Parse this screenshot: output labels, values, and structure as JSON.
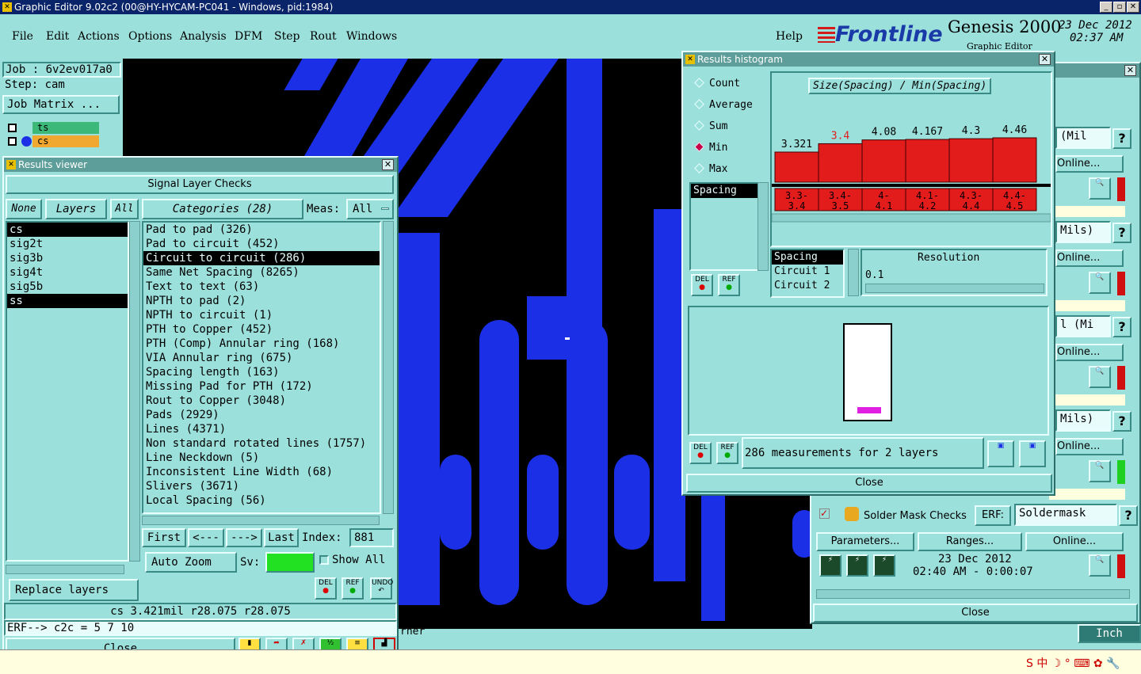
{
  "window": {
    "title": "Graphic Editor 9.02c2 (00@HY-HYCAM-PC041 - Windows, pid:1984)"
  },
  "menu": [
    "File",
    "Edit",
    "Actions",
    "Options",
    "Analysis",
    "DFM",
    "Step",
    "Rout",
    "Windows"
  ],
  "help": "Help",
  "brand": {
    "logo": "Frontline",
    "product": "Genesis 2000",
    "sub": "Graphic Editor",
    "date": "23 Dec 2012",
    "time": "02:37 AM"
  },
  "job": {
    "job": "Job : 6v2ev017a0",
    "step": "Step: cam",
    "matrix_btn": "Job Matrix ...",
    "layers": [
      "ts",
      "cs"
    ]
  },
  "results_viewer": {
    "title": "Results viewer",
    "header": "Signal Layer Checks",
    "none": "None",
    "layers_btn": "Layers",
    "all": "All",
    "categories_btn": "Categories (28)",
    "meas_label": "Meas:",
    "meas_value": "All",
    "layers": [
      "cs",
      "sig2t",
      "sig3b",
      "sig4t",
      "sig5b",
      "ss"
    ],
    "categories": [
      "Pad to pad (326)",
      "Pad to circuit (452)",
      "Circuit to circuit (286)",
      "Same Net Spacing (8265)",
      "Text to text (63)",
      "NPTH to pad (2)",
      "NPTH to circuit (1)",
      "PTH to Copper (452)",
      "PTH (Comp) Annular ring (168)",
      "VIA Annular ring (675)",
      "Spacing length (163)",
      "Missing Pad for PTH (172)",
      "Rout to Copper (3048)",
      "Pads (2929)",
      "Lines (4371)",
      "Non standard rotated lines (1757)",
      "Line Neckdown (5)",
      "Inconsistent Line Width (68)",
      "Slivers (3671)",
      "Local Spacing (56)"
    ],
    "nav": {
      "first": "First",
      "prev": "<---",
      "next": "--->",
      "last": "Last",
      "index_label": "Index:",
      "index": "881"
    },
    "auto_zoom": "Auto Zoom",
    "sv": "Sv:",
    "show_all": "Show All",
    "del": "DEL",
    "ref": "REF",
    "undo": "UNDO",
    "replace": "Replace layers",
    "status": "cs 3.421mil  r28.075  r28.075",
    "erf": "ERF--> c2c = 5 7 10",
    "close": "Close"
  },
  "histogram": {
    "title": "Results histogram",
    "modes": [
      "Count",
      "Average",
      "Sum",
      "Min",
      "Max"
    ],
    "selected_mode": "Min",
    "chart_title": "Size(Spacing) / Min(Spacing)",
    "bar_values": [
      "3.321",
      "3.4",
      "4.08",
      "4.167",
      "4.3",
      "4.46"
    ],
    "bins": [
      "3.3-3.4",
      "3.4-3.5",
      "4-4.1",
      "4.1-4.2",
      "4.3-4.4",
      "4.4-4.5"
    ],
    "attr_list": [
      "Spacing"
    ],
    "sort_list": [
      "Spacing",
      "Circuit 1",
      "Circuit 2"
    ],
    "resolution_label": "Resolution",
    "resolution": "0.1",
    "summary": "286 measurements for 2 layers",
    "close": "Close"
  },
  "checklist": {
    "rows": [
      {
        "text": "(Mil",
        "online": "Online..."
      },
      {
        "text": "Mils)",
        "online": "Online..."
      },
      {
        "text": "l (Mi",
        "online": "Online..."
      },
      {
        "text": "Mils)",
        "online": "Online..."
      }
    ],
    "solder": {
      "label": "Solder Mask Checks",
      "erf": "ERF:",
      "erf_value": "Soldermask",
      "q": "?"
    },
    "params": "Parameters...",
    "ranges": "Ranges...",
    "online": "Online...",
    "run_date": "23 Dec 2012",
    "run_time": "02:40 AM - 0:00:07",
    "close": "Close"
  },
  "bottom": {
    "corner_text": "rner",
    "units": "Inch"
  },
  "colors": {
    "bg": "#9ce0dc",
    "copper": "#1b2fe6",
    "bar": "#e21b1b"
  }
}
